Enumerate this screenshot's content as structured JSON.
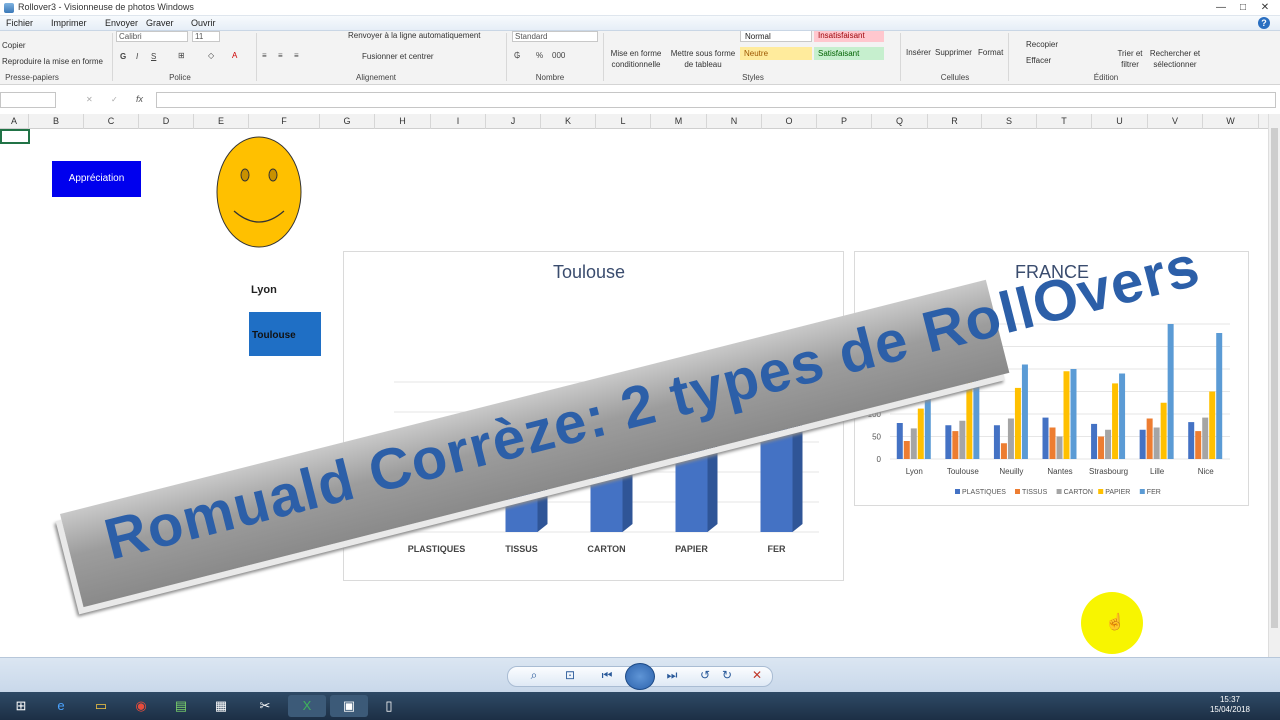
{
  "viewer": {
    "title": "Rollover3 - Visionneuse de photos Windows",
    "menu": [
      "Fichier",
      "Imprimer",
      "Envoyer",
      "Graver",
      "Ouvrir"
    ],
    "help": "?"
  },
  "ribbon": {
    "clipboard": {
      "copy": "Copier",
      "format_painter": "Reproduire la mise en forme",
      "group": "Presse-papiers"
    },
    "font": {
      "name": "Calibri",
      "size": "11",
      "bold": "G",
      "italic": "I",
      "underline": "S",
      "group": "Police"
    },
    "alignment": {
      "wrap": "Renvoyer à la ligne automatiquement",
      "merge": "Fusionner et centrer",
      "group": "Alignement"
    },
    "number": {
      "format": "Standard",
      "percent": "%",
      "thousands": "000",
      "group": "Nombre"
    },
    "styles": {
      "conditional": "Mise en forme conditionnelle",
      "table": "Mettre sous forme de tableau",
      "normal": "Normal",
      "bad": "Insatisfaisant",
      "neutral": "Neutre",
      "good": "Satisfaisant",
      "group": "Styles"
    },
    "cells": {
      "insert": "Insérer",
      "delete": "Supprimer",
      "format": "Format",
      "group": "Cellules"
    },
    "editing": {
      "fill": "Recopier",
      "clear": "Effacer",
      "sort": "Trier et filtrer",
      "find": "Rechercher et sélectionner",
      "group": "Édition"
    }
  },
  "formula": {
    "fx": "fx"
  },
  "columns": [
    "A",
    "B",
    "C",
    "D",
    "E",
    "F",
    "G",
    "H",
    "I",
    "J",
    "K",
    "L",
    "M",
    "N",
    "O",
    "P",
    "Q",
    "R",
    "S",
    "T",
    "U",
    "V",
    "W"
  ],
  "sheet": {
    "button_label": "Appréciation",
    "lyon_label": "Lyon",
    "toulouse_label": "Toulouse"
  },
  "chart_data": [
    {
      "type": "bar",
      "title": "Toulouse",
      "categories": [
        "PLASTIQUES",
        "TISSUS",
        "CARTON",
        "PAPIER",
        "FER"
      ],
      "values": [
        null,
        40,
        55,
        100,
        140
      ]
    },
    {
      "type": "bar",
      "title": "FRANCE",
      "categories": [
        "Lyon",
        "Toulouse",
        "Neuilly",
        "Nantes",
        "Strasbourg",
        "Lille",
        "Nice"
      ],
      "y_ticks": [
        "0",
        "50",
        "100",
        "150"
      ],
      "series": [
        {
          "name": "PLASTIQUES",
          "color": "#4472c4",
          "values": [
            80,
            75,
            75,
            92,
            78,
            65,
            82
          ]
        },
        {
          "name": "TISSUS",
          "color": "#ed7d31",
          "values": [
            40,
            62,
            35,
            70,
            50,
            90,
            62
          ]
        },
        {
          "name": "CARTON",
          "color": "#a5a5a5",
          "values": [
            68,
            85,
            90,
            50,
            65,
            70,
            92
          ]
        },
        {
          "name": "PAPIER",
          "color": "#ffc000",
          "values": [
            112,
            225,
            158,
            195,
            168,
            125,
            150
          ]
        },
        {
          "name": "FER",
          "color": "#5b9bd5",
          "values": [
            205,
            275,
            210,
            200,
            190,
            300,
            280
          ]
        }
      ]
    }
  ],
  "banner": {
    "text": "Romuald Corrèze: 2 types de RollOvers"
  },
  "taskbar": {
    "time": "15:37",
    "date": "15/04/2018"
  }
}
